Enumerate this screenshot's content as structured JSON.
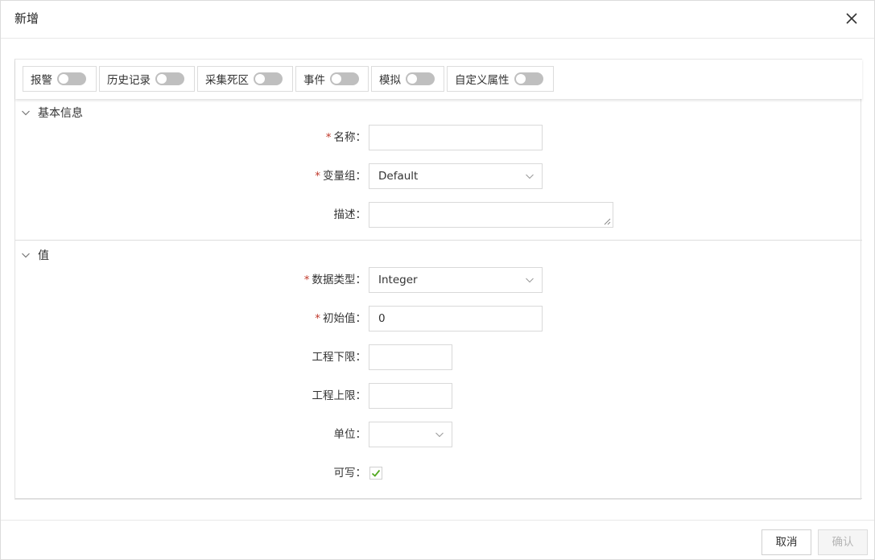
{
  "dialog": {
    "title": "新增",
    "close_icon": "close-icon"
  },
  "toggles": [
    {
      "label": "报警",
      "on": false
    },
    {
      "label": "历史记录",
      "on": false
    },
    {
      "label": "采集死区",
      "on": false
    },
    {
      "label": "事件",
      "on": false
    },
    {
      "label": "模拟",
      "on": false
    },
    {
      "label": "自定义属性",
      "on": false
    }
  ],
  "sections": {
    "basic": {
      "title": "基本信息",
      "name_label": "名称：",
      "name_value": "",
      "group_label": "变量组：",
      "group_value": "Default",
      "desc_label": "描述：",
      "desc_value": ""
    },
    "value": {
      "title": "值",
      "datatype_label": "数据类型：",
      "datatype_value": "Integer",
      "initial_label": "初始值：",
      "initial_value": "0",
      "eng_low_label": "工程下限：",
      "eng_low_value": "",
      "eng_high_label": "工程上限：",
      "eng_high_value": "",
      "unit_label": "单位：",
      "unit_value": "",
      "writable_label": "可写：",
      "writable_checked": true
    }
  },
  "required_mark": "*",
  "footer": {
    "cancel_label": "取消",
    "confirm_label": "确认"
  },
  "colors": {
    "required": "#c0392b",
    "check": "#52a81f",
    "switch_off": "#bfbfbf"
  }
}
